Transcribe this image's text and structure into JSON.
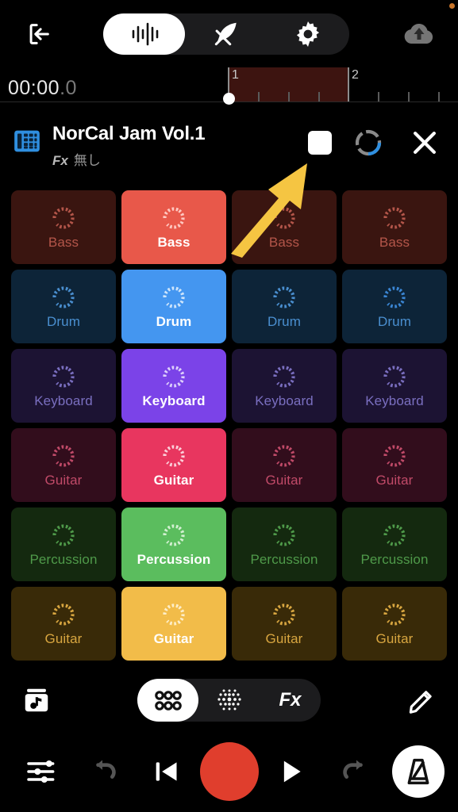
{
  "topbar": {
    "exit_label": "exit-to-app",
    "tabs": [
      {
        "id": "waveform",
        "icon": "waveform-icon",
        "active": true
      },
      {
        "id": "quill",
        "icon": "quill-icon",
        "active": false
      },
      {
        "id": "settings",
        "icon": "gear-icon",
        "active": false
      }
    ],
    "cloud_label": "cloud-upload",
    "notification_dot_color": "#c8752a"
  },
  "timeline": {
    "timecode_main": "00:00",
    "timecode_frac": ".0",
    "bars": [
      "1",
      "2"
    ],
    "loop_region_color": "#3d1410",
    "playhead_position_bar": "1"
  },
  "project": {
    "icon": "pad-grid-icon",
    "title": "NorCal Jam Vol.1",
    "fx_label": "Fx",
    "fx_value": "無し",
    "stop_button": "stop-button",
    "loop_button": "loop-progress-ring",
    "close_button": "close-button",
    "loop_ring_accent": "#2f8fe0"
  },
  "grid": {
    "columns": 4,
    "rows": 6,
    "cells": [
      {
        "label": "Bass",
        "lit": false,
        "bg": "#3a1510",
        "fg": "#b4564a",
        "ring": "#b4564a"
      },
      {
        "label": "Bass",
        "lit": true,
        "bg": "#e8584a",
        "fg": "#ffffff",
        "ring": "#ffc9c2"
      },
      {
        "label": "Bass",
        "lit": false,
        "bg": "#3a1510",
        "fg": "#b4564a",
        "ring": "#b4564a"
      },
      {
        "label": "Bass",
        "lit": false,
        "bg": "#3a1510",
        "fg": "#b4564a",
        "ring": "#b4564a"
      },
      {
        "label": "Drum",
        "lit": false,
        "bg": "#0d2438",
        "fg": "#4a8fd0",
        "ring": "#4a8fd0"
      },
      {
        "label": "Drum",
        "lit": true,
        "bg": "#4496f0",
        "fg": "#ffffff",
        "ring": "#cfe5fb"
      },
      {
        "label": "Drum",
        "lit": false,
        "bg": "#0d2438",
        "fg": "#4a8fd0",
        "ring": "#4a8fd0"
      },
      {
        "label": "Drum",
        "lit": false,
        "bg": "#0d2438",
        "fg": "#4a8fd0",
        "ring": "#3b86d4"
      },
      {
        "label": "Keyboard",
        "lit": false,
        "bg": "#1c1333",
        "fg": "#7a6fc0",
        "ring": "#7a6fc0"
      },
      {
        "label": "Keyboard",
        "lit": true,
        "bg": "#7b43e8",
        "fg": "#ffffff",
        "ring": "#ddd0fb"
      },
      {
        "label": "Keyboard",
        "lit": false,
        "bg": "#1c1333",
        "fg": "#7a6fc0",
        "ring": "#7a6fc0"
      },
      {
        "label": "Keyboard",
        "lit": false,
        "bg": "#1c1333",
        "fg": "#7a6fc0",
        "ring": "#7a6fc0"
      },
      {
        "label": "Guitar",
        "lit": false,
        "bg": "#320d1c",
        "fg": "#c04a68",
        "ring": "#c04a68"
      },
      {
        "label": "Guitar",
        "lit": true,
        "bg": "#e8365f",
        "fg": "#ffffff",
        "ring": "#fbd0da"
      },
      {
        "label": "Guitar",
        "lit": false,
        "bg": "#320d1c",
        "fg": "#c04a68",
        "ring": "#c04a68"
      },
      {
        "label": "Guitar",
        "lit": false,
        "bg": "#320d1c",
        "fg": "#c04a68",
        "ring": "#c04a68"
      },
      {
        "label": "Percussion",
        "lit": false,
        "bg": "#14290f",
        "fg": "#4f9a4a",
        "ring": "#4f9a4a"
      },
      {
        "label": "Percussion",
        "lit": true,
        "bg": "#5bbd5e",
        "fg": "#ffffff",
        "ring": "#d4f0d2"
      },
      {
        "label": "Percussion",
        "lit": false,
        "bg": "#14290f",
        "fg": "#4f9a4a",
        "ring": "#4f9a4a"
      },
      {
        "label": "Percussion",
        "lit": false,
        "bg": "#14290f",
        "fg": "#4f9a4a",
        "ring": "#4f9a4a"
      },
      {
        "label": "Guitar",
        "lit": false,
        "bg": "#392a08",
        "fg": "#d8a640",
        "ring": "#d8a640"
      },
      {
        "label": "Guitar",
        "lit": true,
        "bg": "#f2bc49",
        "fg": "#ffffff",
        "ring": "#fdeec9"
      },
      {
        "label": "Guitar",
        "lit": false,
        "bg": "#392a08",
        "fg": "#d8a640",
        "ring": "#d8a640"
      },
      {
        "label": "Guitar",
        "lit": false,
        "bg": "#392a08",
        "fg": "#d8a640",
        "ring": "#d8a640"
      }
    ]
  },
  "modebar": {
    "library_label": "sound-library",
    "tabs": [
      {
        "id": "pads",
        "icon": "pads-grid-icon",
        "label": "",
        "active": true
      },
      {
        "id": "notes",
        "icon": "dot-matrix-icon",
        "label": "",
        "active": false
      },
      {
        "id": "fx",
        "icon": "fx-text",
        "label": "Fx",
        "active": false
      }
    ],
    "edit_label": "edit-pencil"
  },
  "transport": {
    "mixer_label": "mixer-settings",
    "undo_label": "undo",
    "back_label": "skip-to-start",
    "record_label": "record",
    "record_color": "#e03e2d",
    "play_label": "play",
    "redo_label": "redo",
    "metronome_label": "metronome"
  },
  "annotation": {
    "arrow_color": "#f5c542",
    "points_to": "stop-button"
  }
}
